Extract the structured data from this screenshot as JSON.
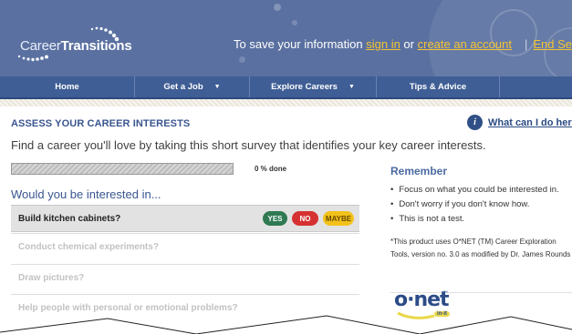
{
  "header": {
    "logo_light": "Career",
    "logo_bold": "Transitions",
    "message_prefix": "To save your information ",
    "sign_in": "sign in",
    "message_or": " or ",
    "create_account": "create an account",
    "end_session": "End Sessio"
  },
  "nav": {
    "items": [
      {
        "label": "Home"
      },
      {
        "label": "Get a Job",
        "caret": "▼"
      },
      {
        "label": "Explore Careers",
        "caret": "▼"
      },
      {
        "label": "Tips & Advice"
      }
    ]
  },
  "main": {
    "section_title": "ASSESS YOUR CAREER INTERESTS",
    "help_icon": "i",
    "help_link": "What can I do here?",
    "intro": "Find a career you'll love by taking this short survey that identifies your key career interests.",
    "progress_percent": 0,
    "progress_label": "0 % done",
    "question_heading": "Would you be interested in...",
    "questions": [
      {
        "text": "Build kitchen cabinets?"
      },
      {
        "text": "Conduct chemical experiments?"
      },
      {
        "text": "Draw pictures?"
      },
      {
        "text": "Help people with personal or emotional problems?"
      }
    ],
    "answers": {
      "yes": "YES",
      "no": "NO",
      "maybe": "MAYBE"
    }
  },
  "sidebar": {
    "remember_title": "Remember",
    "tips": [
      "Focus on what you could be interested in.",
      "Don't worry if you don't know how.",
      "This is not a test."
    ],
    "onet_note": "*This product uses O*NET (TM) Career Exploration Tools, version no. 3.0 as modified by Dr. James Rounds",
    "onet_logo_text": "o·net",
    "onet_logo_tm": "™",
    "onet_logo_sub": "in-it"
  },
  "colors": {
    "header_bg": "#5a70a0",
    "nav_bg": "#3f5e95",
    "link_yellow": "#f5c431",
    "heading_blue": "#3a5690",
    "yes_green": "#2f7a52",
    "no_red": "#d63131",
    "maybe_yellow": "#f2c21a"
  }
}
